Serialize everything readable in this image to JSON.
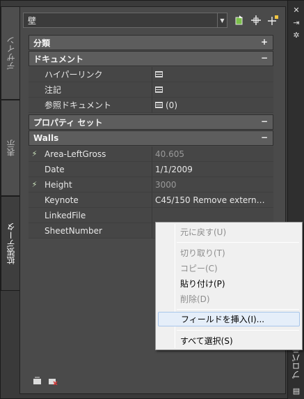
{
  "tabs": {
    "design": "デザイン",
    "display": "表示",
    "extended": "拡張データ"
  },
  "selector": {
    "value": "壁"
  },
  "sections": [
    {
      "title": "分類",
      "toggle": "+"
    },
    {
      "title": "ドキュメント",
      "toggle": "−"
    },
    {
      "title": "プロパティ セット",
      "toggle": "−"
    },
    {
      "title": "Walls",
      "toggle": "−"
    }
  ],
  "document_rows": [
    {
      "name": "ハイパーリンク",
      "value": ""
    },
    {
      "name": "注記",
      "value": ""
    },
    {
      "name": "参照ドキュメント",
      "value": "(0)"
    }
  ],
  "walls_rows": [
    {
      "name": "Area-LeftGross",
      "value": "40.605",
      "dim": true,
      "icon": "formula-icon"
    },
    {
      "name": "Date",
      "value": "1/1/2009",
      "dim": false
    },
    {
      "name": "Height",
      "value": "3000",
      "dim": true,
      "icon": "formula-icon"
    },
    {
      "name": "Keynote",
      "value": "C45/150  Remove  extern…",
      "dim": false
    },
    {
      "name": "LinkedFile",
      "value": "",
      "dim": false
    },
    {
      "name": "SheetNumber",
      "value": "",
      "dim": false
    }
  ],
  "context_menu": {
    "undo": "元に戻す(U)",
    "cut": "切り取り(T)",
    "copy": "コピー(C)",
    "paste": "貼り付け(P)",
    "delete": "削除(D)",
    "insert_field": "フィールドを挿入(I)...",
    "select_all": "すべて選択(S)"
  },
  "palette_title": "プロパティ",
  "colors": {
    "panel": "#4a4a4a",
    "category": "#5d5d5d",
    "menu_highlight": "#e5eef9"
  }
}
